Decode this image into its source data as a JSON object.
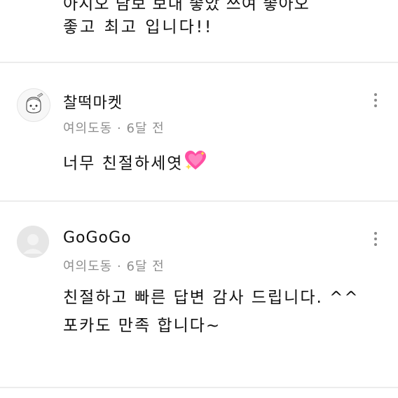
{
  "previous_review": {
    "line1": "아지오 담보 보내 좋았 쓰여 좋아오",
    "line2": "좋고 최고 입니다!!"
  },
  "reviews": [
    {
      "nickname": "찰떡마켓",
      "location": "여의도동",
      "separator": "·",
      "time": "6달 전",
      "text_lines": [
        "너무 친절하세엿"
      ],
      "emoji": "sparkling-heart-icon"
    },
    {
      "nickname": "GoGoGo",
      "location": "여의도동",
      "separator": "·",
      "time": "6달 전",
      "text_lines": [
        "친절하고 빠른 답변 감사 드립니다. ^^",
        "포카도 만족 합니다~"
      ]
    }
  ],
  "colors": {
    "divider": "#ececec",
    "meta_text": "#8e8e8e",
    "heart": "#ff4fa3",
    "default_avatar": "#e6e6e6"
  }
}
